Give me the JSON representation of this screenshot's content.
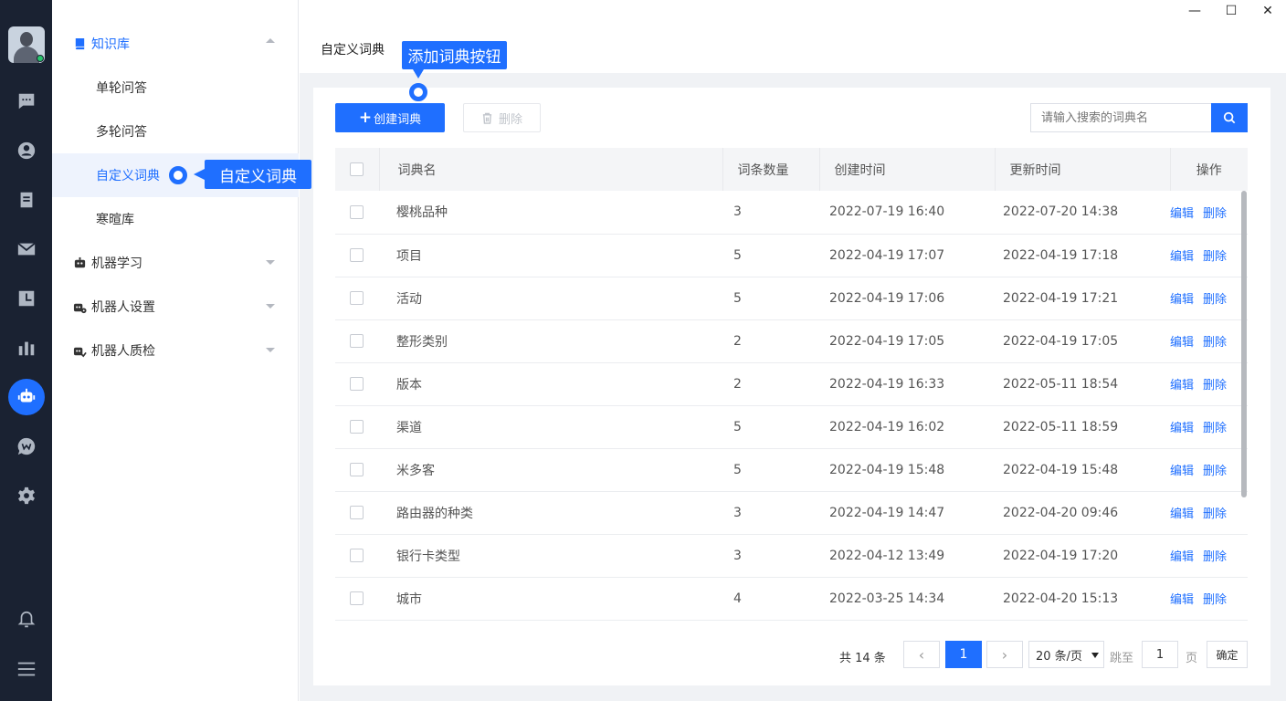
{
  "window_controls": {
    "minimize": "—",
    "maximize": "☐",
    "close": "✕"
  },
  "rail": {
    "icons": [
      "chat-icon",
      "user-icon",
      "clipboard-icon",
      "mail-icon",
      "clock-icon",
      "bar-chart-icon",
      "robot-icon",
      "wechat-icon",
      "gear-icon",
      "bell-icon",
      "hamburger-menu-icon"
    ],
    "active": "robot-icon"
  },
  "menu": {
    "knowledge_base": "知识库",
    "sub_items": [
      "单轮问答",
      "多轮问答",
      "自定义词典",
      "寒暄库"
    ],
    "selected": "自定义词典",
    "machine_learning": "机器学习",
    "robot_settings": "机器人设置",
    "robot_qc": "机器人质检"
  },
  "tab": {
    "title": "自定义词典"
  },
  "toolbar": {
    "create_label": "创建词典",
    "create_plus": "+",
    "delete_label": "删除",
    "search_placeholder": "请输入搜索的词典名"
  },
  "table": {
    "headers": [
      "词典名",
      "词条数量",
      "创建时间",
      "更新时间",
      "操作"
    ],
    "edit_label": "编辑",
    "delete_label": "删除",
    "rows": [
      {
        "name": "樱桃品种",
        "count": "3",
        "created": "2022-07-19 16:40",
        "updated": "2022-07-20 14:38"
      },
      {
        "name": "项目",
        "count": "5",
        "created": "2022-04-19 17:07",
        "updated": "2022-04-19 17:18"
      },
      {
        "name": "活动",
        "count": "5",
        "created": "2022-04-19 17:06",
        "updated": "2022-04-19 17:21"
      },
      {
        "name": "整形类别",
        "count": "2",
        "created": "2022-04-19 17:05",
        "updated": "2022-04-19 17:05"
      },
      {
        "name": "版本",
        "count": "2",
        "created": "2022-04-19 16:33",
        "updated": "2022-05-11 18:54"
      },
      {
        "name": "渠道",
        "count": "5",
        "created": "2022-04-19 16:02",
        "updated": "2022-05-11 18:59"
      },
      {
        "name": "米多客",
        "count": "5",
        "created": "2022-04-19 15:48",
        "updated": "2022-04-19 15:48"
      },
      {
        "name": "路由器的种类",
        "count": "3",
        "created": "2022-04-19 14:47",
        "updated": "2022-04-20 09:46"
      },
      {
        "name": "银行卡类型",
        "count": "3",
        "created": "2022-04-12 13:49",
        "updated": "2022-04-19 17:20"
      },
      {
        "name": "城市",
        "count": "4",
        "created": "2022-03-25 14:34",
        "updated": "2022-04-20 15:13"
      }
    ]
  },
  "pagination": {
    "total": "共 14 条",
    "prev": "‹",
    "current": "1",
    "next": "›",
    "page_size": "20 条/页",
    "jump_label": "跳至",
    "jump_value": "1",
    "page_suffix": "页",
    "confirm": "确定"
  },
  "callouts": {
    "add_dictionary_button": "添加词典按钮",
    "custom_dictionary": "自定义词典"
  },
  "colors": {
    "accent": "#1f6fff",
    "rail_bg": "#1a2232",
    "page_bg": "#f0f2f5"
  }
}
